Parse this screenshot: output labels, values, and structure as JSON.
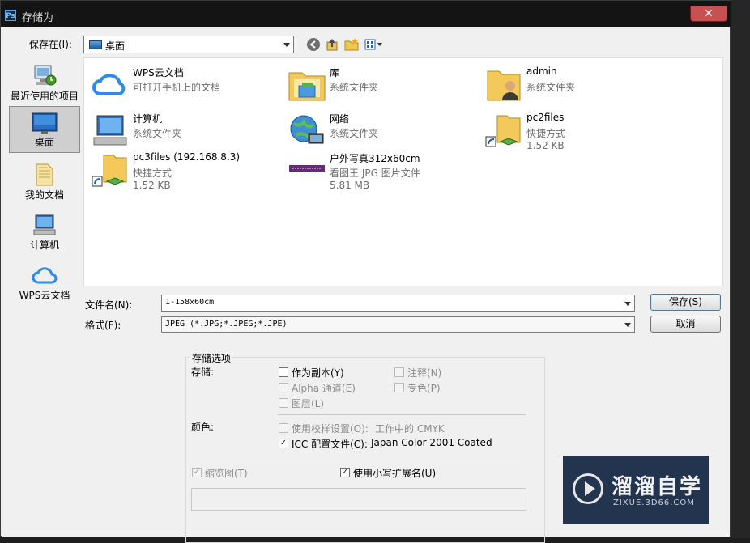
{
  "window": {
    "title": "存储为",
    "app_icon_text": "Ps",
    "close_glyph": "✕"
  },
  "location": {
    "label": "保存在(I):",
    "value": "桌面"
  },
  "places": [
    {
      "label": "最近使用的项目",
      "icon": "recent-icon"
    },
    {
      "label": "桌面",
      "icon": "desktop-icon",
      "selected": true
    },
    {
      "label": "我的文档",
      "icon": "documents-icon"
    },
    {
      "label": "计算机",
      "icon": "computer-icon"
    },
    {
      "label": "WPS云文档",
      "icon": "cloud-icon"
    }
  ],
  "files": [
    {
      "name": "WPS云文档",
      "line2": "可打开手机上的文档",
      "line3": "",
      "icon": "cloud-icon"
    },
    {
      "name": "库",
      "line2": "系统文件夹",
      "line3": "",
      "icon": "library-icon"
    },
    {
      "name": "admin",
      "line2": "系统文件夹",
      "line3": "",
      "icon": "user-folder-icon"
    },
    {
      "name": "计算机",
      "line2": "系统文件夹",
      "line3": "",
      "icon": "computer-icon"
    },
    {
      "name": "网络",
      "line2": "系统文件夹",
      "line3": "",
      "icon": "network-icon"
    },
    {
      "name": "pc2files",
      "line2": "快捷方式",
      "line3": "1.52 KB",
      "icon": "shortcut-folder-icon"
    },
    {
      "name": "pc3files (192.168.8.3)",
      "line2": "快捷方式",
      "line3": "1.52 KB",
      "icon": "shortcut-folder-icon"
    },
    {
      "name": "户外写真312x60cm",
      "line2": "看图王 JPG 图片文件",
      "line3": "5.81 MB",
      "icon": "jpg-thumbnail-icon"
    }
  ],
  "filename": {
    "label": "文件名(N):",
    "value": "1-158x60cm"
  },
  "format": {
    "label": "格式(F):",
    "value": "JPEG (*.JPG;*.JPEG;*.JPE)"
  },
  "buttons": {
    "save": "保存(S)",
    "cancel": "取消"
  },
  "options": {
    "group_title": "存储选项",
    "save_label": "存储:",
    "as_copy": "作为副本(Y)",
    "notes": "注释(N)",
    "alpha": "Alpha 通道(E)",
    "spot": "专色(P)",
    "layers": "图层(L)",
    "color_label": "颜色:",
    "proof": "使用校样设置(O):",
    "proof_value": "工作中的 CMYK",
    "icc": "ICC 配置文件(C):",
    "icc_value": "Japan Color 2001 Coated",
    "thumbnail": "缩览图(T)",
    "lowercase_ext": "使用小写扩展名(U)"
  },
  "checkbox_states": {
    "as_copy": false,
    "notes": false,
    "alpha": false,
    "spot": false,
    "layers": false,
    "proof": false,
    "icc": true,
    "thumbnail": true,
    "lowercase_ext": true
  },
  "watermark": {
    "title": "溜溜自学",
    "subtitle": "ZIXUE.3D66.COM"
  },
  "colors": {
    "title_bar": "#141414",
    "dialog_bg": "#f0f0f0",
    "close_button": "#c75050",
    "watermark_bg": "#23344f"
  }
}
